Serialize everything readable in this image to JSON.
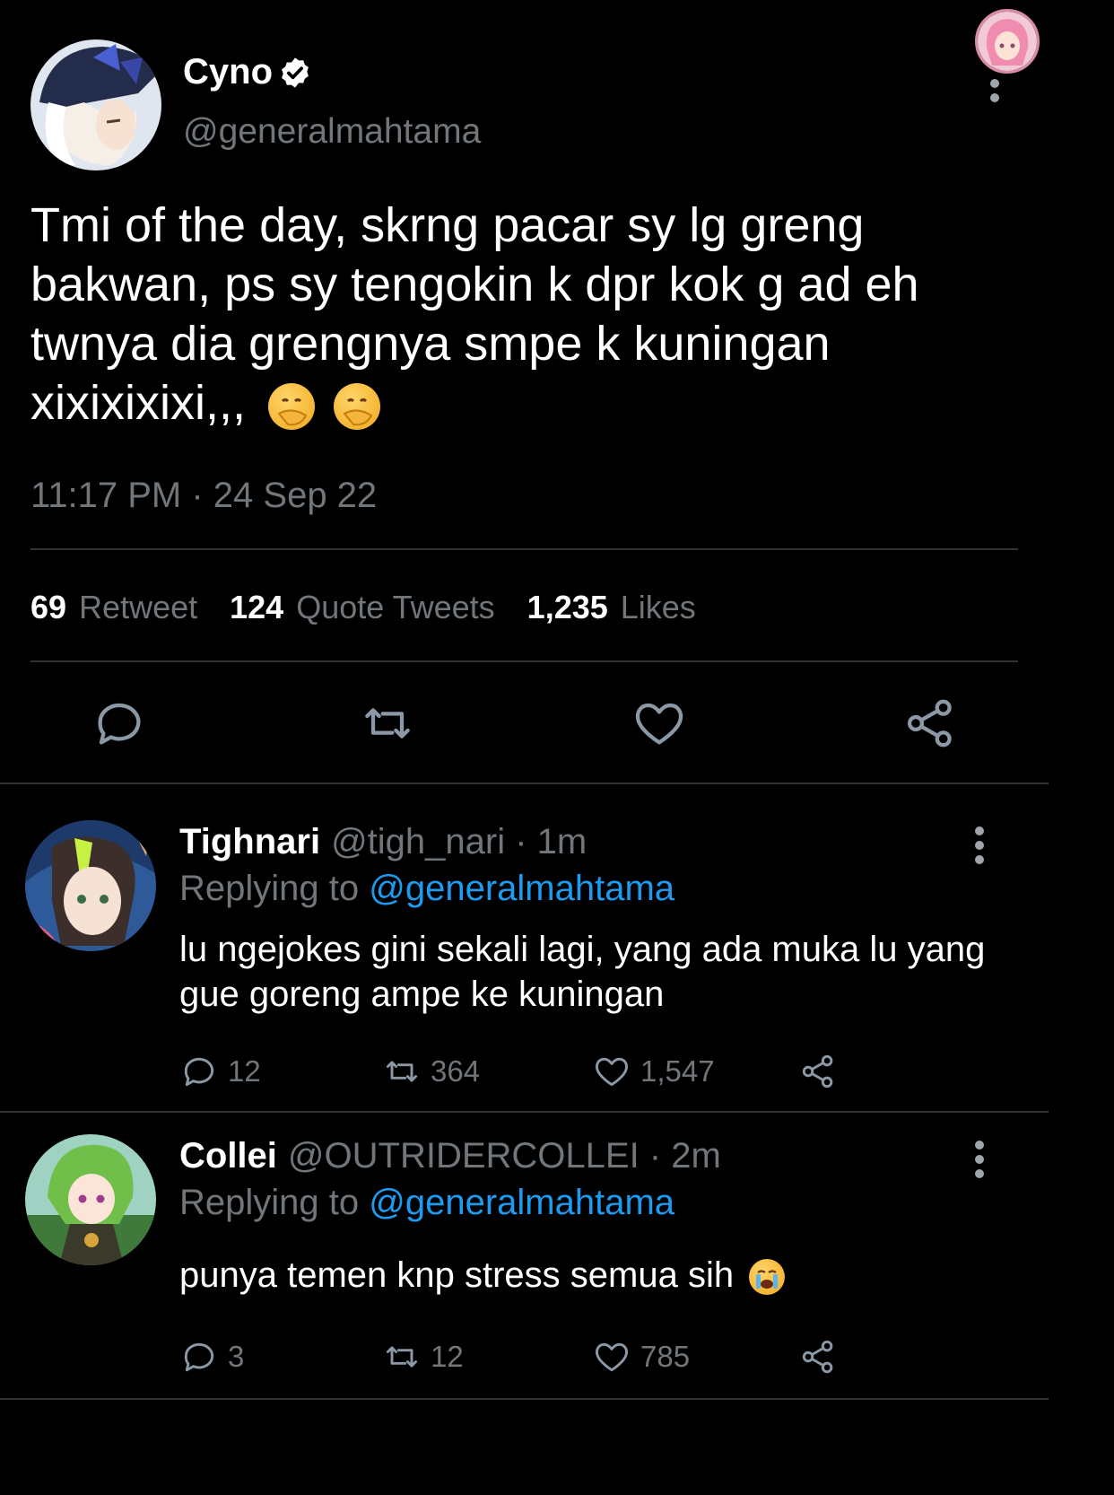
{
  "header": {
    "menu_icon": "vertical-dots-icon",
    "profile_icon": "avatar-anime-pink-hair"
  },
  "tweet": {
    "author_name": "Cyno",
    "verified_icon": "verified-badge-icon",
    "handle": "@generalmahtama",
    "text": "Tmi of the day, skrng pacar sy lg greng bakwan, ps sy tengokin k dpr kok g ad eh twnya dia grengnya smpe k kuningan xixixixixi,,,",
    "emoji": [
      "hand-over-mouth-emoji",
      "hand-over-mouth-emoji"
    ],
    "timestamp": "11:17 PM · 24 Sep 22",
    "stats": [
      {
        "count": "69",
        "label": "Retweet"
      },
      {
        "count": "124",
        "label": "Quote Tweets"
      },
      {
        "count": "1,235",
        "label": "Likes"
      }
    ],
    "actions": [
      "reply-icon",
      "retweet-icon",
      "like-icon",
      "share-icon"
    ]
  },
  "replies": [
    {
      "name": "Tighnari",
      "handle": "@tigh_nari · 1m",
      "replying_label": "Replying to",
      "replying_handle": "@generalmahtama",
      "text": "lu ngejokes gini sekali lagi, yang ada muka lu yang gue goreng ampe ke kuningan",
      "replies": "12",
      "retweets": "364",
      "likes": "1,547"
    },
    {
      "name": "Collei",
      "handle": "@OUTRIDERCOLLEI · 2m",
      "replying_label": "Replying to",
      "replying_handle": "@generalmahtama",
      "text": "punya temen knp stress semua sih",
      "emoji": "loudly-crying-emoji",
      "replies": "3",
      "retweets": "12",
      "likes": "785"
    }
  ],
  "colors": {
    "background": "#000000",
    "link": "#1d9bf0",
    "muted": "#71767b",
    "divider": "#2f3336"
  }
}
